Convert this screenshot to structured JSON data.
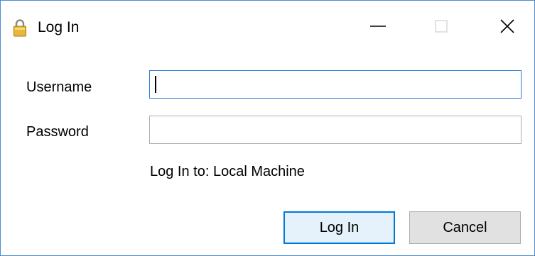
{
  "window": {
    "title": "Log In",
    "icon": "lock-icon",
    "controls": {
      "minimize_icon": "minimize-icon",
      "maximize_icon": "maximize-icon",
      "close_icon": "close-icon"
    }
  },
  "form": {
    "username_label": "Username",
    "username_value": "",
    "password_label": "Password",
    "password_value": "",
    "target_text": "Log In to: Local Machine"
  },
  "buttons": {
    "login_label": "Log In",
    "cancel_label": "Cancel"
  },
  "colors": {
    "window_border": "#4a8bd0",
    "focus_border": "#2c7ad6",
    "default_button_border": "#0078d7",
    "default_button_fill": "#e5f1fb",
    "button_fill": "#e1e1e1"
  }
}
